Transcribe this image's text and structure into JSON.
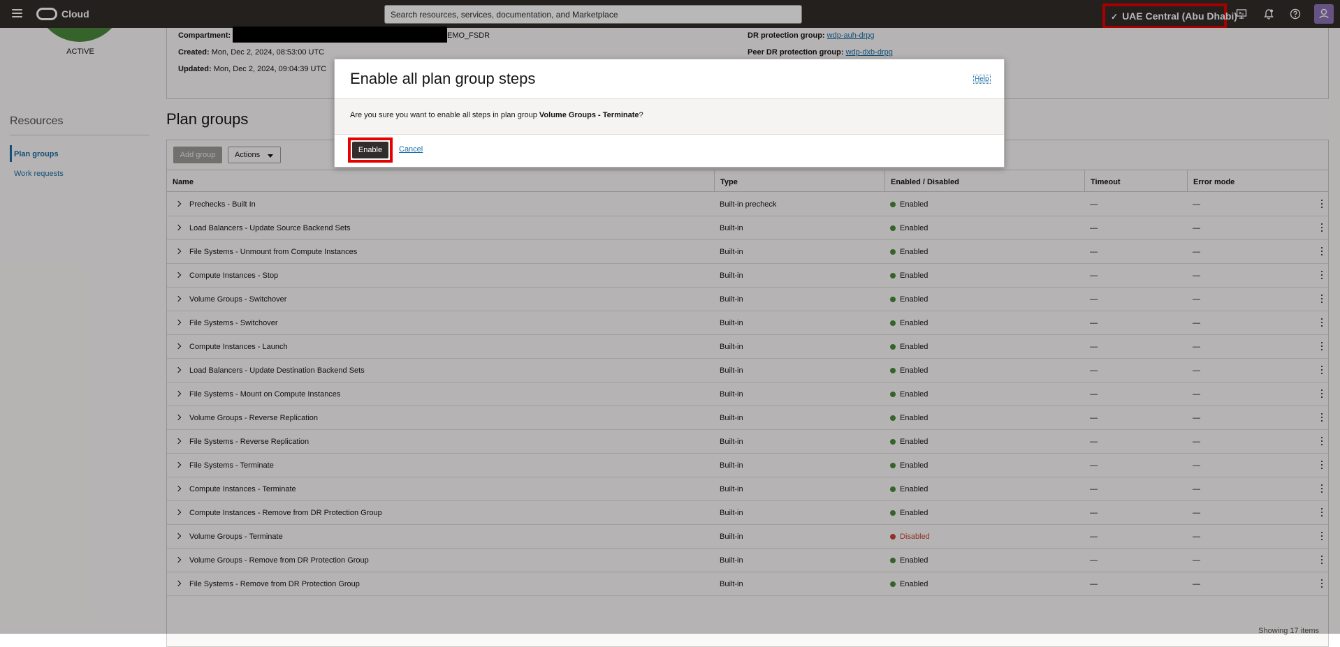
{
  "header": {
    "brand": "Cloud",
    "search_placeholder": "Search resources, services, documentation, and Marketplace",
    "region": "UAE Central (Abu Dhabi)"
  },
  "details": {
    "status": "ACTIVE",
    "compartment_label": "Compartment:",
    "compartment_value_visible": "EMO_FSDR",
    "created_label": "Created:",
    "created_value": "Mon, Dec 2, 2024, 08:53:00 UTC",
    "updated_label": "Updated:",
    "updated_value": "Mon, Dec 2, 2024, 09:04:39 UTC",
    "dr_group_label": "DR protection group:",
    "dr_group_value": "wdp-auh-drpg",
    "peer_group_label": "Peer DR protection group:",
    "peer_group_value": "wdp-dxb-drpg"
  },
  "resources": {
    "title": "Resources",
    "items": [
      {
        "label": "Plan groups",
        "active": true
      },
      {
        "label": "Work requests",
        "active": false
      }
    ]
  },
  "plan_groups": {
    "title": "Plan groups",
    "add_button": "Add group",
    "actions_button": "Actions",
    "columns": [
      "Name",
      "Type",
      "Enabled / Disabled",
      "Timeout",
      "Error mode"
    ],
    "rows": [
      {
        "name": "Prechecks - Built In",
        "type": "Built-in precheck",
        "state": "Enabled",
        "timeout": "—",
        "error_mode": "—"
      },
      {
        "name": "Load Balancers - Update Source Backend Sets",
        "type": "Built-in",
        "state": "Enabled",
        "timeout": "—",
        "error_mode": "—"
      },
      {
        "name": "File Systems - Unmount from Compute Instances",
        "type": "Built-in",
        "state": "Enabled",
        "timeout": "—",
        "error_mode": "—"
      },
      {
        "name": "Compute Instances - Stop",
        "type": "Built-in",
        "state": "Enabled",
        "timeout": "—",
        "error_mode": "—"
      },
      {
        "name": "Volume Groups - Switchover",
        "type": "Built-in",
        "state": "Enabled",
        "timeout": "—",
        "error_mode": "—"
      },
      {
        "name": "File Systems - Switchover",
        "type": "Built-in",
        "state": "Enabled",
        "timeout": "—",
        "error_mode": "—"
      },
      {
        "name": "Compute Instances - Launch",
        "type": "Built-in",
        "state": "Enabled",
        "timeout": "—",
        "error_mode": "—"
      },
      {
        "name": "Load Balancers - Update Destination Backend Sets",
        "type": "Built-in",
        "state": "Enabled",
        "timeout": "—",
        "error_mode": "—"
      },
      {
        "name": "File Systems - Mount on Compute Instances",
        "type": "Built-in",
        "state": "Enabled",
        "timeout": "—",
        "error_mode": "—"
      },
      {
        "name": "Volume Groups - Reverse Replication",
        "type": "Built-in",
        "state": "Enabled",
        "timeout": "—",
        "error_mode": "—"
      },
      {
        "name": "File Systems - Reverse Replication",
        "type": "Built-in",
        "state": "Enabled",
        "timeout": "—",
        "error_mode": "—"
      },
      {
        "name": "File Systems - Terminate",
        "type": "Built-in",
        "state": "Enabled",
        "timeout": "—",
        "error_mode": "—"
      },
      {
        "name": "Compute Instances - Terminate",
        "type": "Built-in",
        "state": "Enabled",
        "timeout": "—",
        "error_mode": "—"
      },
      {
        "name": "Compute Instances - Remove from DR Protection Group",
        "type": "Built-in",
        "state": "Enabled",
        "timeout": "—",
        "error_mode": "—"
      },
      {
        "name": "Volume Groups - Terminate",
        "type": "Built-in",
        "state": "Disabled",
        "timeout": "—",
        "error_mode": "—"
      },
      {
        "name": "Volume Groups - Remove from DR Protection Group",
        "type": "Built-in",
        "state": "Enabled",
        "timeout": "—",
        "error_mode": "—"
      },
      {
        "name": "File Systems - Remove from DR Protection Group",
        "type": "Built-in",
        "state": "Enabled",
        "timeout": "—",
        "error_mode": "—"
      }
    ],
    "footer": "Showing 17 items"
  },
  "modal": {
    "title": "Enable all plan group steps",
    "help": "Help",
    "message_prefix": "Are you sure you want to enable all steps in plan group ",
    "message_group": "Volume Groups - Terminate",
    "message_suffix": "?",
    "enable_button": "Enable",
    "cancel_link": "Cancel"
  },
  "colors": {
    "topbar": "#312d2a",
    "link": "#1b6fa8",
    "enabled": "#4c8a3c",
    "disabled": "#c74634",
    "highlight": "#e60000"
  }
}
